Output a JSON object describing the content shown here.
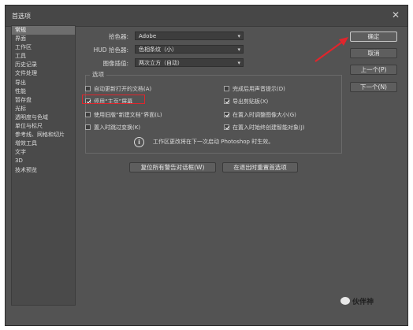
{
  "window": {
    "title": "首选项",
    "close": "✕"
  },
  "sidebar": {
    "items": [
      {
        "label": "常规",
        "selected": true
      },
      {
        "label": "界面",
        "selected": false
      },
      {
        "label": "工作区",
        "selected": false
      },
      {
        "label": "工具",
        "selected": false
      },
      {
        "label": "历史记录",
        "selected": false
      },
      {
        "label": "文件处理",
        "selected": false
      },
      {
        "label": "导出",
        "selected": false
      },
      {
        "label": "性能",
        "selected": false
      },
      {
        "label": "暂存盘",
        "selected": false
      },
      {
        "label": "光标",
        "selected": false
      },
      {
        "label": "透明度与色域",
        "selected": false
      },
      {
        "label": "单位与标尺",
        "selected": false
      },
      {
        "label": "参考线、网格和切片",
        "selected": false
      },
      {
        "label": "增效工具",
        "selected": false
      },
      {
        "label": "文字",
        "selected": false
      },
      {
        "label": "3D",
        "selected": false
      },
      {
        "label": "技术预览",
        "selected": false
      }
    ]
  },
  "general": {
    "picker_label": "拾色器:",
    "picker_value": "Adobe",
    "hud_label": "HUD 拾色器:",
    "hud_value": "色相条纹（小）",
    "interp_label": "图像插值:",
    "interp_value": "两次立方（自动）"
  },
  "options": {
    "legend": "选项",
    "auto_open": "自动更新打开的文档(A)",
    "beep": "完成后用声音提示(D)",
    "home_screen": "停用“主页”屏幕",
    "export_clipboard": "导出剪贴板(X)",
    "legacy_new_doc": "使用旧版“新建文档”界面(L)",
    "resize_on_place": "在置入时调整图像大小(G)",
    "skip_transform": "置入时跳过变换(K)",
    "smart_objects": "在置入时始终创建智能对象(J)",
    "info_text": "工作区更改将在下一次启动 Photoshop 时生效。"
  },
  "bottom_buttons": {
    "reset_warnings": "复位所有警告对话框(W)",
    "reset_on_quit": "在退出时重置首选项"
  },
  "right_buttons": {
    "ok": "确定",
    "cancel": "取消",
    "prev": "上一个(P)",
    "next": "下一个(N)"
  },
  "watermark": {
    "text": "伙伴神"
  },
  "colors": {
    "highlight": "#e0252c",
    "arrow": "#e0252c",
    "dialog_bg": "#535353"
  }
}
